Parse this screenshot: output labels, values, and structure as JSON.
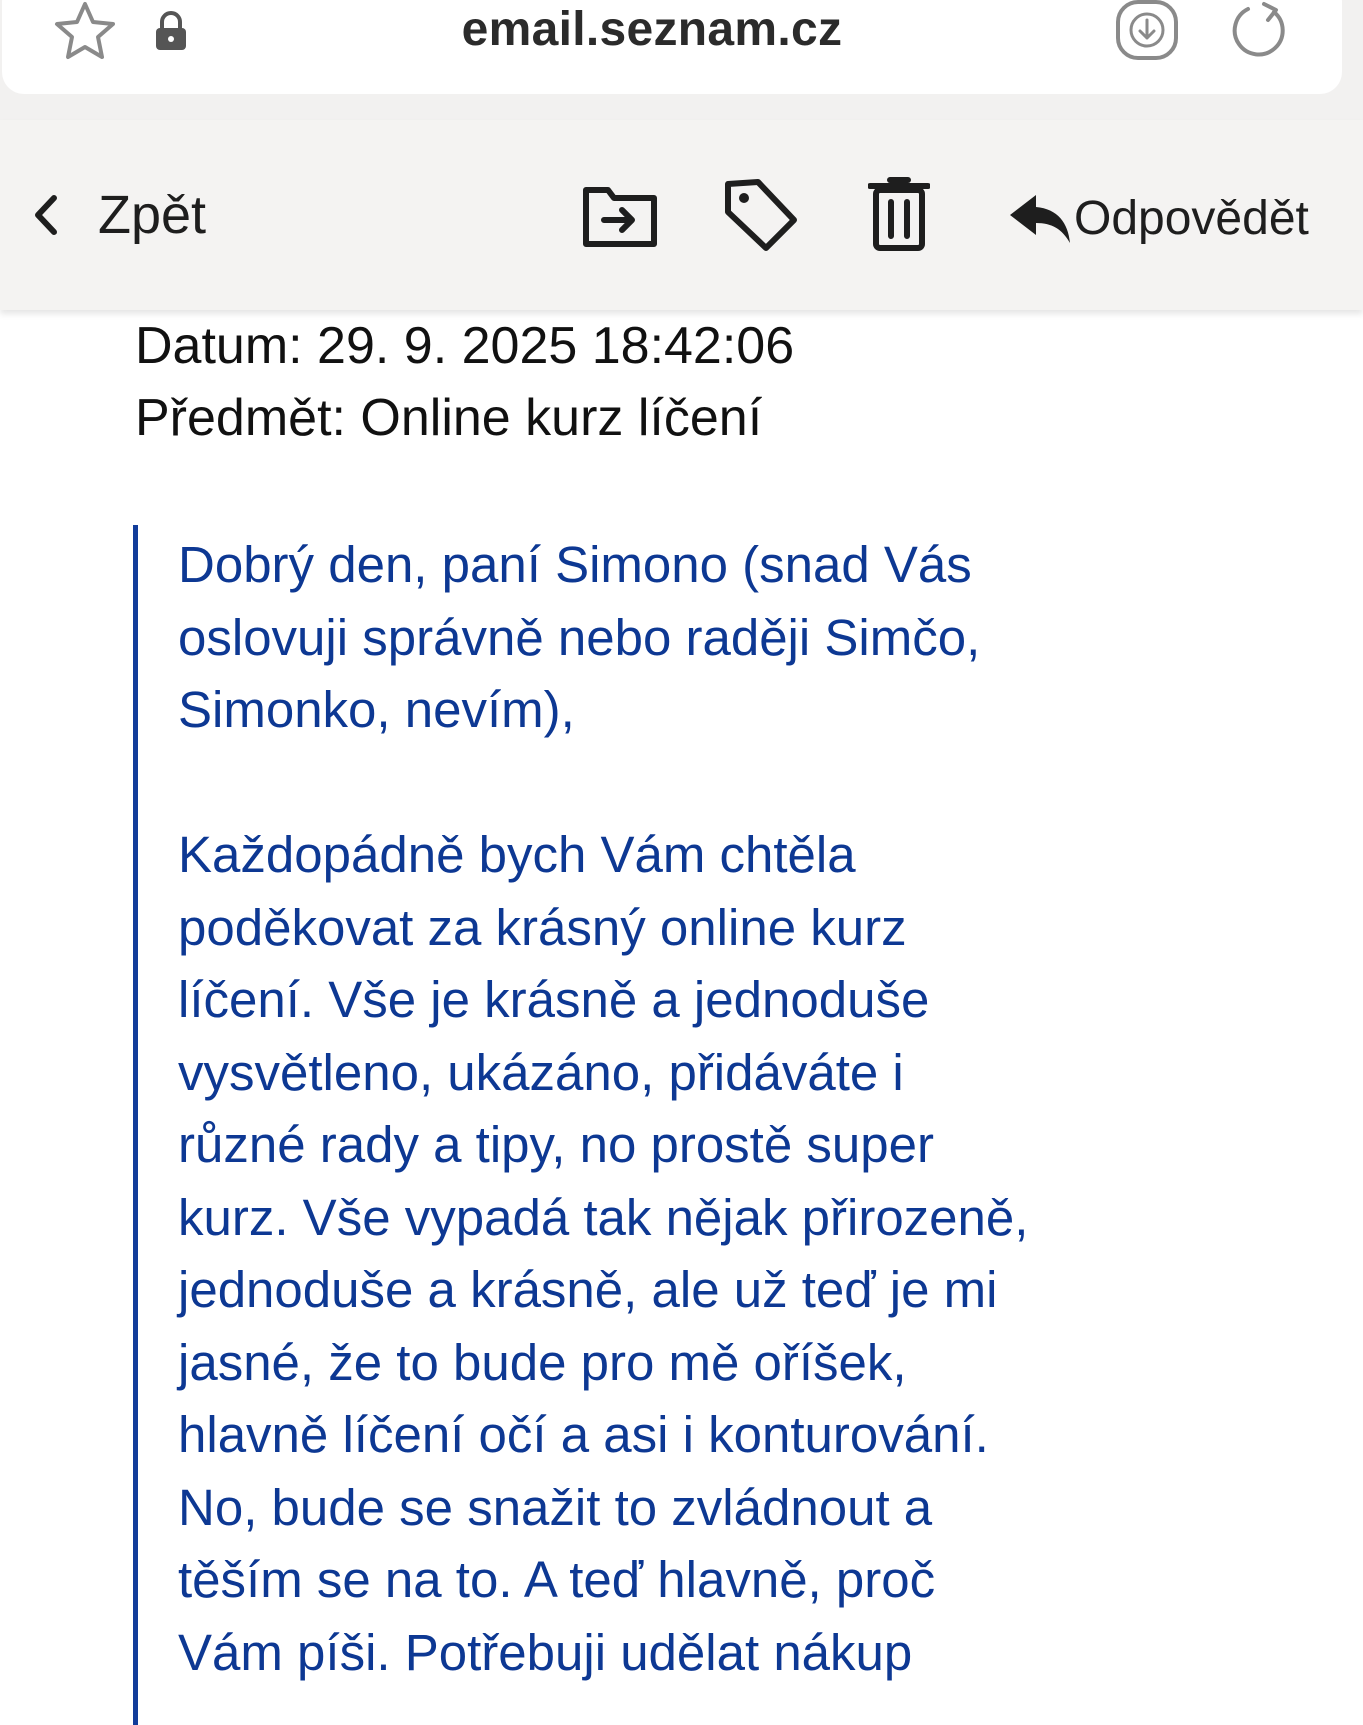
{
  "browser": {
    "url": "email.seznam.cz",
    "icons": [
      "star-icon",
      "lock-icon",
      "download-icon",
      "reload-icon"
    ]
  },
  "toolbar": {
    "back_label": "Zpět",
    "reply_label": "Odpovědět",
    "icons": [
      "chevron-left-icon",
      "move-to-folder-icon",
      "tag-icon",
      "trash-icon",
      "reply-icon"
    ]
  },
  "message": {
    "date_line": "Datum: 29. 9. 2025 18:42:06",
    "subject_line": "Předmět: Online kurz líčení"
  },
  "quote": {
    "paragraph1": [
      "Dobrý den, paní Simono (snad Vás",
      "oslovuji správně nebo raději Simčo,",
      "Simonko, nevím),"
    ],
    "paragraph2": [
      "Každopádně bych Vám chtěla",
      "poděkovat za krásný online kurz",
      "líčení. Vše je krásně a jednoduše",
      "vysvětleno, ukázáno, přidáváte i",
      "různé rady a tipy, no prostě super",
      "kurz. Vše vypadá tak nějak přirozeně,",
      "jednoduše a krásně, ale už teď je mi",
      "jasné, že to bude pro mě oříšek,",
      "hlavně líčení očí a asi i konturování.",
      "No, bude se snažit to zvládnout a",
      "těším se na to. A teď hlavně, proč",
      "Vám píši. Potřebuji udělat nákup"
    ]
  },
  "colors": {
    "quote_text": "#0d3893",
    "quote_border": "#123c9a",
    "toolbar_bg": "#f4f3f2"
  }
}
